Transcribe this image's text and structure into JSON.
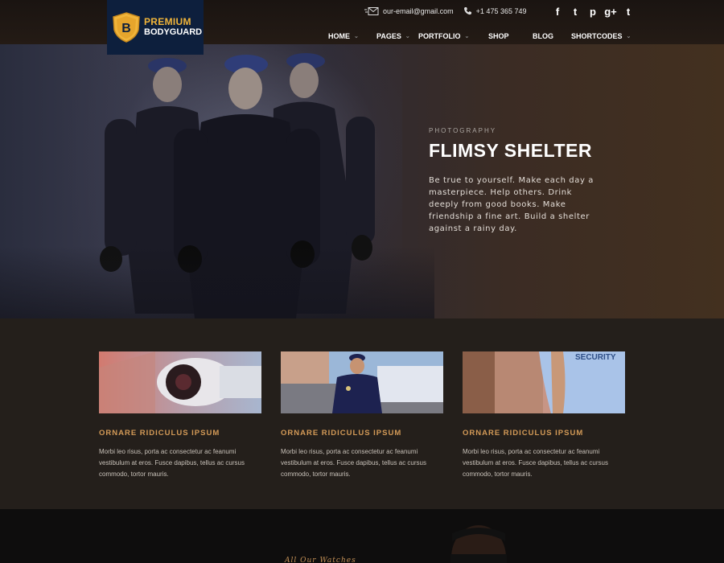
{
  "brand": {
    "line1": "PREMIUM",
    "line2": "BODYGUARD",
    "mark": "B"
  },
  "contact": {
    "email": "our-email@gmail.com",
    "phone": "+1 475 365 749"
  },
  "social": [
    {
      "name": "facebook-icon",
      "glyph": "f"
    },
    {
      "name": "twitter-icon",
      "glyph": "t"
    },
    {
      "name": "pinterest-icon",
      "glyph": "p"
    },
    {
      "name": "google-plus-icon",
      "glyph": "g+"
    },
    {
      "name": "tumblr-icon",
      "glyph": "t"
    }
  ],
  "nav": [
    {
      "label": "HOME",
      "dropdown": true
    },
    {
      "label": "PAGES",
      "dropdown": true
    },
    {
      "label": "PORTFOLIO",
      "dropdown": true
    },
    {
      "label": "SHOP",
      "dropdown": false
    },
    {
      "label": "BLOG",
      "dropdown": false
    },
    {
      "label": "SHORTCODES",
      "dropdown": true
    }
  ],
  "hero": {
    "kicker": "PHOTOGRAPHY",
    "title": "FLIMSY SHELTER",
    "description": "Be true to yourself. Make each day a masterpiece. Help others. Drink deeply from good books. Make friendship a fine art. Build a shelter against a rainy day."
  },
  "services": [
    {
      "title": "ORNARE RIDICULUS IPSUM",
      "body": "Morbi leo risus, porta ac consectetur ac feanumi vestibulum at eros. Fusce dapibus, tellus ac cursus commodo, tortor mauris."
    },
    {
      "title": "ORNARE RIDICULUS IPSUM",
      "body": "Morbi leo risus, porta ac consectetur ac feanumi vestibulum at eros. Fusce dapibus, tellus ac cursus commodo, tortor mauris."
    },
    {
      "title": "ORNARE RIDICULUS IPSUM",
      "body": "Morbi leo risus, porta ac consectetur ac feanumi vestibulum at eros. Fusce dapibus, tellus ac cursus commodo, tortor mauris.",
      "image_text": "SECURITY"
    }
  ],
  "bottom": {
    "label": "All Our Watches"
  },
  "colors": {
    "accent": "#d39a57",
    "logo_bg": "#0d1f3d",
    "logo_gold": "#f0b43a"
  }
}
